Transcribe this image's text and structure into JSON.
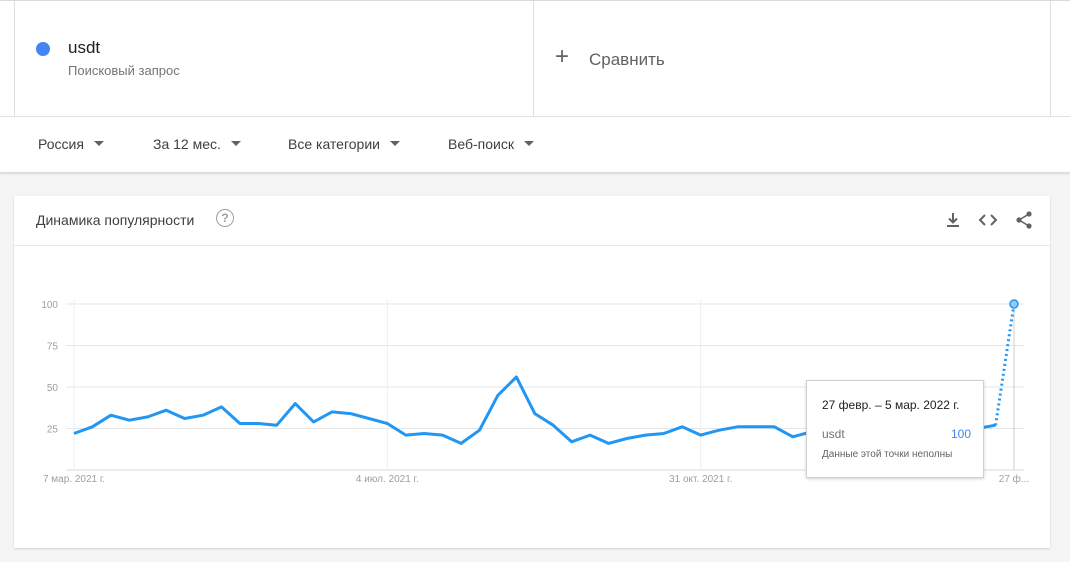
{
  "term": {
    "name": "usdt",
    "type": "Поисковый запрос",
    "color": "#4285f4"
  },
  "compare": {
    "label": "Сравнить",
    "icon": "plus-icon"
  },
  "filters": [
    {
      "label": "Россия"
    },
    {
      "label": "За 12 мес."
    },
    {
      "label": "Все категории"
    },
    {
      "label": "Веб-поиск"
    }
  ],
  "card": {
    "title": "Динамика популярности",
    "tools": [
      "download-icon",
      "embed-icon",
      "share-icon"
    ]
  },
  "tooltip": {
    "date": "27 февр. – 5 мар. 2022 г.",
    "term": "usdt",
    "value": "100",
    "note": "Данные этой точки неполны"
  },
  "chart_data": {
    "type": "line",
    "ylim": [
      0,
      100
    ],
    "yticks": [
      25,
      50,
      75,
      100
    ],
    "xtick_labels": [
      {
        "label": "7 мар. 2021 г.",
        "index": 0
      },
      {
        "label": "4 июл. 2021 г.",
        "index": 17
      },
      {
        "label": "31 окт. 2021 г.",
        "index": 34
      },
      {
        "label": "27 ф...",
        "index": 51
      }
    ],
    "grid": true,
    "series": [
      {
        "name": "usdt",
        "color": "#2196f3",
        "values": [
          22,
          26,
          33,
          30,
          32,
          36,
          31,
          33,
          38,
          28,
          28,
          27,
          40,
          29,
          35,
          34,
          31,
          28,
          21,
          22,
          21,
          16,
          24,
          45,
          56,
          34,
          27,
          17,
          21,
          16,
          19,
          21,
          22,
          26,
          21,
          24,
          26,
          26,
          26,
          20,
          23,
          25,
          27,
          22,
          26,
          27,
          25,
          23,
          24,
          25,
          27,
          100
        ],
        "partial_from_index": 50
      }
    ]
  }
}
